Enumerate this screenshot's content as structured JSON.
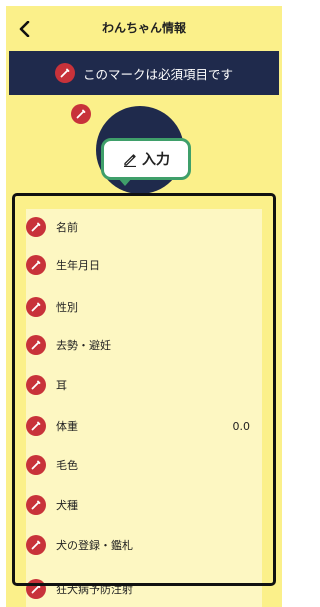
{
  "header": {
    "title": "わんちゃん情報"
  },
  "banner": {
    "text": "このマークは必須項目です"
  },
  "tooltip": {
    "label": "入力"
  },
  "fields": [
    {
      "label": "名前",
      "value": ""
    },
    {
      "label": "生年月日",
      "value": ""
    },
    {
      "label": "性別",
      "value": ""
    },
    {
      "label": "去勢・避妊",
      "value": ""
    },
    {
      "label": "耳",
      "value": ""
    },
    {
      "label": "体重",
      "value": "0.0"
    },
    {
      "label": "毛色",
      "value": ""
    },
    {
      "label": "犬種",
      "value": ""
    },
    {
      "label": "犬の登録・鑑札",
      "value": ""
    },
    {
      "label": "狂犬病予防注射",
      "value": ""
    }
  ],
  "colors": {
    "background": "#fbf08a",
    "banner": "#1f2a4c",
    "required_mark": "#c8323a",
    "tooltip_border": "#3f9f6a"
  }
}
